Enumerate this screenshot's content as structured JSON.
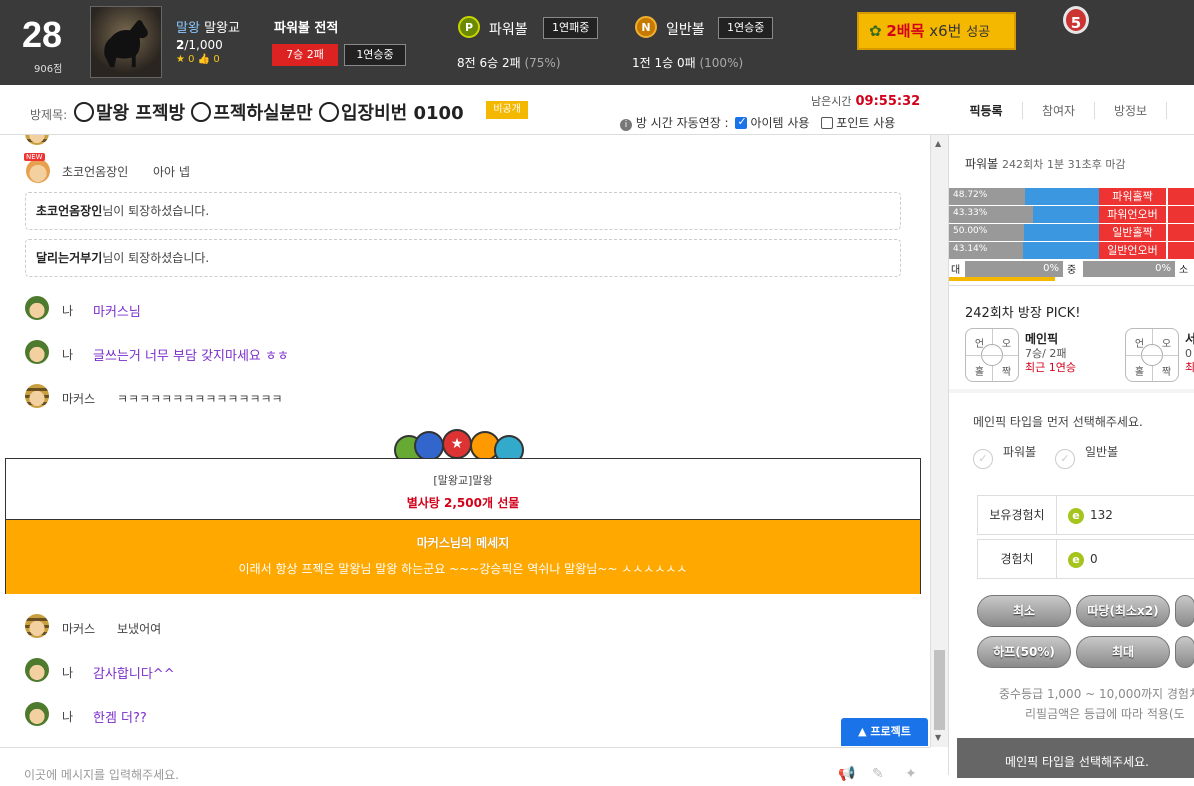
{
  "profile": {
    "level": "28",
    "points": "906점",
    "name_blue": "말왕",
    "name_rest": "말왕교",
    "count_main": "2",
    "count_rest": "/1,000",
    "stars": "0",
    "likes": "0"
  },
  "record": {
    "title": "파워볼 전적",
    "win_loss": "7승 2패",
    "streak": "1연승중"
  },
  "powerball": {
    "icon": "P",
    "label": "파워볼",
    "streak": "1연패중",
    "stat_main": "8전 6승 2패",
    "stat_pct": "(75%)"
  },
  "normalball": {
    "icon": "N",
    "label": "일반볼",
    "streak": "1연승중",
    "stat_main": "1전 1승 0패",
    "stat_pct": "(100%)"
  },
  "bet_badge": {
    "main": "2배목",
    "mult": "x6번",
    "suffix": "성공"
  },
  "medal": "5",
  "room": {
    "label": "방제목:",
    "title_1": "말왕 프젝방",
    "title_2": "프젝하실분만",
    "title_3": "입장비번 0100",
    "private": "비공개",
    "remain_label": "남은시간",
    "remain_time": "09:55:32",
    "option_prefix": "방 시간 자동연장 :",
    "option_item": "아이템 사용",
    "option_point": "포인트 사용"
  },
  "tabs": [
    "픽등록",
    "참여자",
    "방정보",
    "이"
  ],
  "chat": {
    "m1_name": "초코언옴장인",
    "m1_text": "아아 넵",
    "notice1_name": "초코언옴장인",
    "notice1_text": "님이 퇴장하셨습니다.",
    "notice2_name": "달리는거부기",
    "notice2_text": "님이 퇴장하셨습니다.",
    "m2_name": "나",
    "m2_text": "마커스님",
    "m3_name": "나",
    "m3_text": "글쓰는거 너무 부담 갖지마세요 ㅎㅎ",
    "m4_name": "마커스",
    "m4_text": "ㅋㅋㅋㅋㅋㅋㅋㅋㅋㅋㅋㅋㅋㅋㅋ",
    "m5_name": "마커스",
    "m5_text": "보냈어여",
    "m6_name": "나",
    "m6_text": "감사합니다^^",
    "m7_name": "나",
    "m7_text": "한겜 더??"
  },
  "gift": {
    "sender": "[말왕교]말왕",
    "gift_text": "별사탕 2,500개 선물",
    "msg_title": "마커스님의 메세지",
    "msg_body": "이래서 항상 프젝은 말왕님 말왕 하는군요 ~~~강승픽은 역쉬나 말왕님~~ ㅅㅅㅅㅅㅅㅅ"
  },
  "protect_btn": "프로젝트",
  "input_placeholder": "이곳에 메시지를 입력해주세요.",
  "side": {
    "round_title": "파워볼",
    "round_num": "242회차",
    "round_deadline": "1분 31초후 마감",
    "rates": [
      {
        "pct": "48.72%",
        "label": "파워홀짝",
        "value": 48.72
      },
      {
        "pct": "43.33%",
        "label": "파워언오버",
        "value": 43.33
      },
      {
        "pct": "50.00%",
        "label": "일반홀짝",
        "value": 50.0
      },
      {
        "pct": "43.14%",
        "label": "일반언오버",
        "value": 43.14
      }
    ],
    "prog_left_label": "대",
    "prog_left_pct": "0%",
    "prog_mid_label": "중",
    "prog_right_pct": "0%",
    "prog_right_label": "소",
    "pick_title": "242회차 방장 PICK!",
    "pick1_cells": [
      "언",
      "오",
      "홀",
      "짝"
    ],
    "pick1_name": "메인픽",
    "pick1_record": "7승/ 2패",
    "pick1_recent": "최근 1연승",
    "pick2_name": "서",
    "pick2_record": "0",
    "pick2_recent": "최",
    "select_hint": "메인픽 타입을 먼저 선택해주세요.",
    "opt_power": "파워볼",
    "opt_normal": "일반볼",
    "exp_own_label": "보유경험치",
    "exp_own_value": "132",
    "exp_label": "경험치",
    "exp_value": "0",
    "btn_min": "최소",
    "btn_double": "따당(최소x2)",
    "btn_half": "하프(50%)",
    "btn_max": "최대",
    "note1": "중수등급 1,000 ~ 10,000까지 경험치",
    "note2": "리필금액은 등급에 따라 적용(도",
    "submit": "메인픽 타입을 선택해주세요."
  }
}
